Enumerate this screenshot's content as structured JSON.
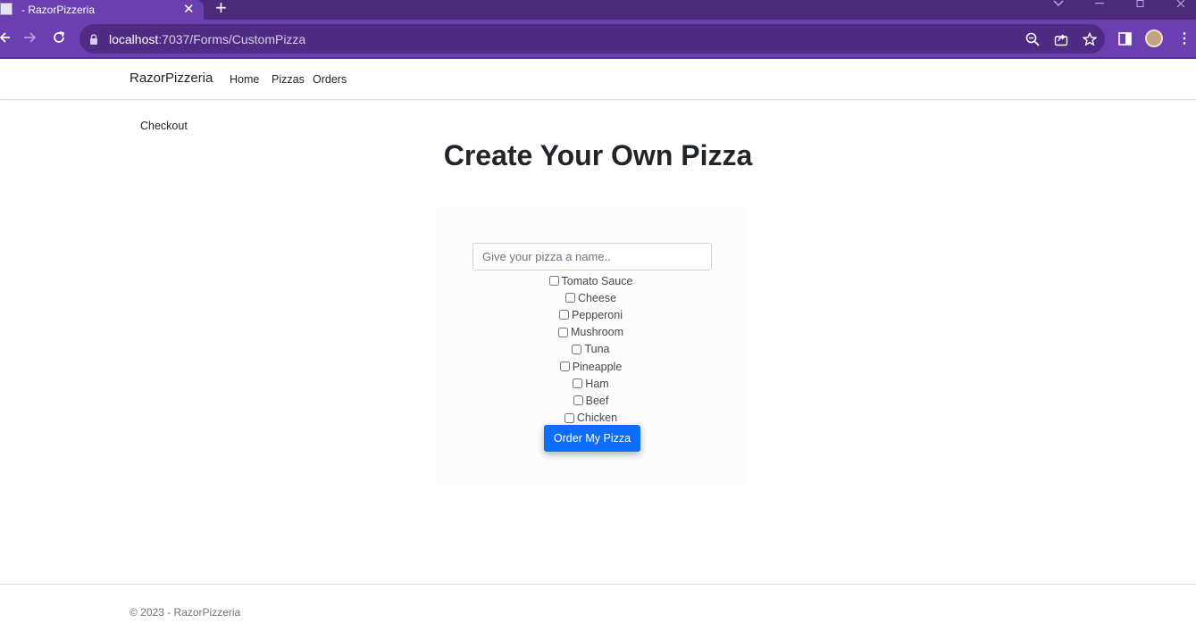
{
  "browser": {
    "tab_title": "- RazorPizzeria",
    "tab_close": "✕",
    "new_tab": "+",
    "url_host": "localhost",
    "url_rest": ":7037/Forms/CustomPizza",
    "frame_color": "#6b3fb0",
    "icons": [
      "back-icon",
      "forward-icon",
      "reload-icon",
      "lock-icon",
      "zoom-icon",
      "share-icon",
      "bookmark-star-icon",
      "side-panel-icon",
      "profile-avatar",
      "menu-kebab-icon"
    ]
  },
  "site": {
    "brand": "RazorPizzeria",
    "nav": [
      {
        "label": "Home"
      },
      {
        "label": "Pizzas"
      },
      {
        "label": "Orders"
      }
    ],
    "checkout": "Checkout"
  },
  "page": {
    "title": "Create Your Own Pizza",
    "name_placeholder": "Give your pizza a name..",
    "toppings": [
      {
        "label": "Tomato Sauce",
        "checked": false
      },
      {
        "label": "Cheese",
        "checked": false
      },
      {
        "label": "Pepperoni",
        "checked": false
      },
      {
        "label": "Mushroom",
        "checked": false
      },
      {
        "label": "Tuna",
        "checked": false
      },
      {
        "label": "Pineapple",
        "checked": false
      },
      {
        "label": "Ham",
        "checked": false
      },
      {
        "label": "Beef",
        "checked": false
      },
      {
        "label": "Chicken",
        "checked": false
      }
    ],
    "submit_label": "Order My Pizza",
    "accent_color": "#0d6efd"
  },
  "footer": {
    "text": "© 2023 - RazorPizzeria"
  }
}
